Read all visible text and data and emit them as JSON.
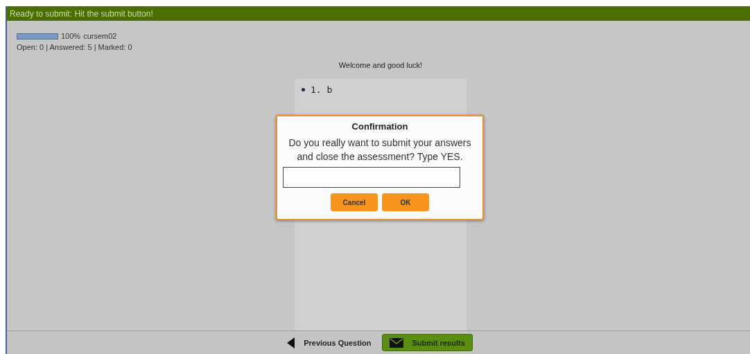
{
  "status_bar": {
    "text": "Ready to submit: Hit the submit button!"
  },
  "progress": {
    "level": 1,
    "percent": "100%",
    "user": "cursem02"
  },
  "summary": "Open: 0 | Answered: 5 | Marked: 0",
  "welcome": "Welcome and good luck!",
  "answers": [
    "1. b"
  ],
  "dialog": {
    "title": "Confirmation",
    "message": "Do you really want to submit your answers and close the assessment? Type YES.",
    "buttons": [
      "Cancel",
      "OK"
    ]
  },
  "footer": {
    "previous": "Previous Question",
    "submit": "Submit results"
  }
}
